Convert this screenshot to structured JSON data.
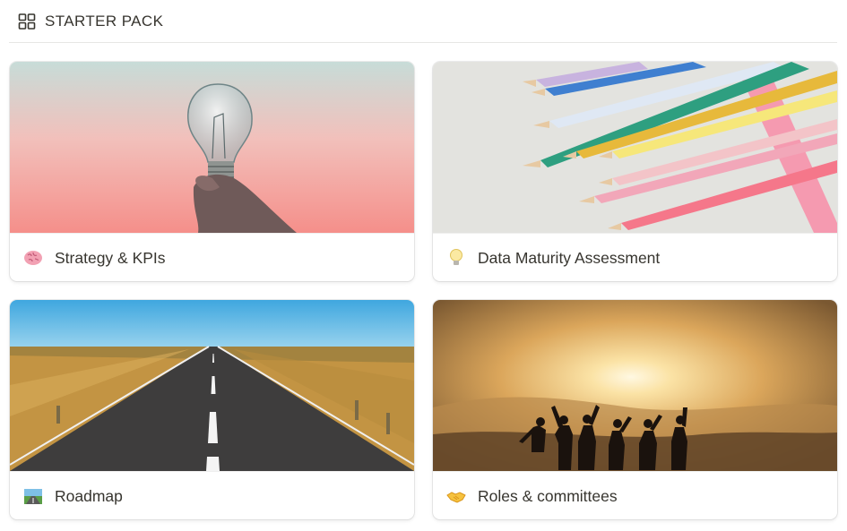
{
  "header": {
    "title": "STARTER PACK",
    "icon": "gallery-grid-icon"
  },
  "cards": [
    {
      "title": "Strategy & KPIs",
      "emoji_icon": "brain-icon",
      "cover": "lightbulb-in-hand-photo"
    },
    {
      "title": "Data Maturity Assessment",
      "emoji_icon": "lightbulb-icon",
      "cover": "colored-pencils-photo"
    },
    {
      "title": "Roadmap",
      "emoji_icon": "motorway-icon",
      "cover": "open-road-photo"
    },
    {
      "title": "Roles & committees",
      "emoji_icon": "handshake-icon",
      "cover": "people-at-sunset-photo"
    }
  ]
}
